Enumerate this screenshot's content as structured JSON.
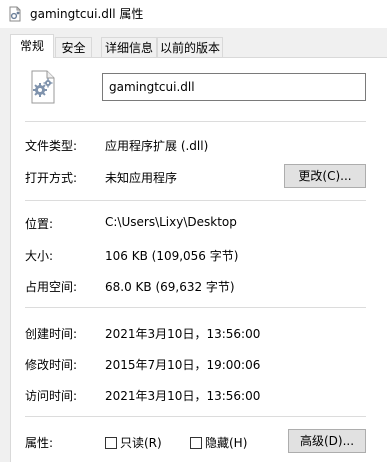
{
  "window": {
    "title": "gamingtcui.dll 属性"
  },
  "tabs": [
    {
      "label": "常规",
      "active": true
    },
    {
      "label": "安全",
      "active": false
    },
    {
      "label": "详细信息",
      "active": false
    },
    {
      "label": "以前的版本",
      "active": false
    }
  ],
  "general": {
    "file_name": "gamingtcui.dll",
    "file_type_label": "文件类型:",
    "file_type_value": "应用程序扩展 (.dll)",
    "opens_with_label": "打开方式:",
    "opens_with_value": "未知应用程序",
    "change_button": "更改(C)...",
    "location_label": "位置:",
    "location_value": "C:\\Users\\Lixy\\Desktop",
    "size_label": "大小:",
    "size_value": "106 KB (109,056 字节)",
    "size_on_disk_label": "占用空间:",
    "size_on_disk_value": "68.0 KB (69,632 字节)",
    "created_label": "创建时间:",
    "created_value": "2021年3月10日，13:56:00",
    "modified_label": "修改时间:",
    "modified_value": "2015年7月10日，19:00:06",
    "accessed_label": "访问时间:",
    "accessed_value": "2021年3月10日，13:56:00",
    "attributes_label": "属性:",
    "readonly_label": "只读(R)",
    "readonly_checked": false,
    "hidden_label": "隐藏(H)",
    "hidden_checked": false,
    "advanced_button": "高级(D)..."
  },
  "icons": {
    "title_icon": "dll-file-icon",
    "file_icon": "dll-gear-file-icon"
  },
  "colors": {
    "panel_bg": "#ffffff",
    "window_bg": "#f0f0f0",
    "button_bg": "#e1e1e1",
    "divider": "#dcdcdc"
  }
}
